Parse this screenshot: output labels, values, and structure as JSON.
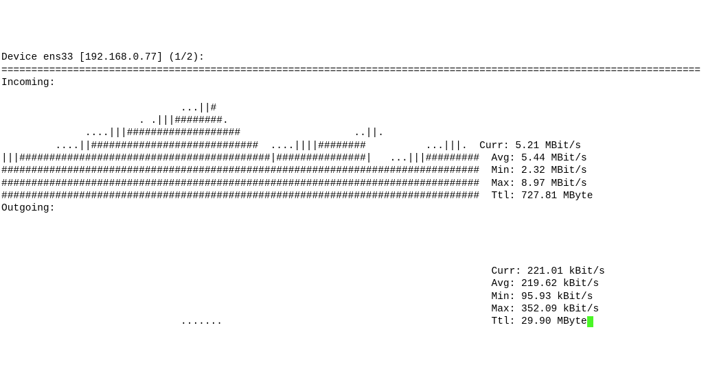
{
  "header": {
    "device_label": "Device",
    "interface": "ens33",
    "ip": "192.168.0.77",
    "page": "1/2"
  },
  "divider": "=====================================================================================================================",
  "incoming": {
    "label": "Incoming:",
    "graph_lines": [
      "                              ...||#",
      "                       . .|||########.",
      "              ....|||###################                   ..||.",
      "         ....||############################  ....||||########          ...|||.",
      "|||##########################################|###############|   ...|||#########",
      "################################################################################",
      "################################################################################",
      "################################################################################"
    ],
    "stats": {
      "curr_label": "Curr:",
      "curr": "5.21 MBit/s",
      "avg_label": "Avg:",
      "avg": "5.44 MBit/s",
      "min_label": "Min:",
      "min": "2.32 MBit/s",
      "max_label": "Max:",
      "max": "8.97 MBit/s",
      "ttl_label": "Ttl:",
      "ttl": "727.81 MByte"
    }
  },
  "outgoing": {
    "label": "Outgoing:",
    "graph_lines": [
      "                              .......                                           "
    ],
    "stats": {
      "curr_label": "Curr:",
      "curr": "221.01 kBit/s",
      "avg_label": "Avg:",
      "avg": "219.62 kBit/s",
      "min_label": "Min:",
      "min": "95.93 kBit/s",
      "max_label": "Max:",
      "max": "352.09 kBit/s",
      "ttl_label": "Ttl:",
      "ttl": "29.90 MByte"
    }
  }
}
